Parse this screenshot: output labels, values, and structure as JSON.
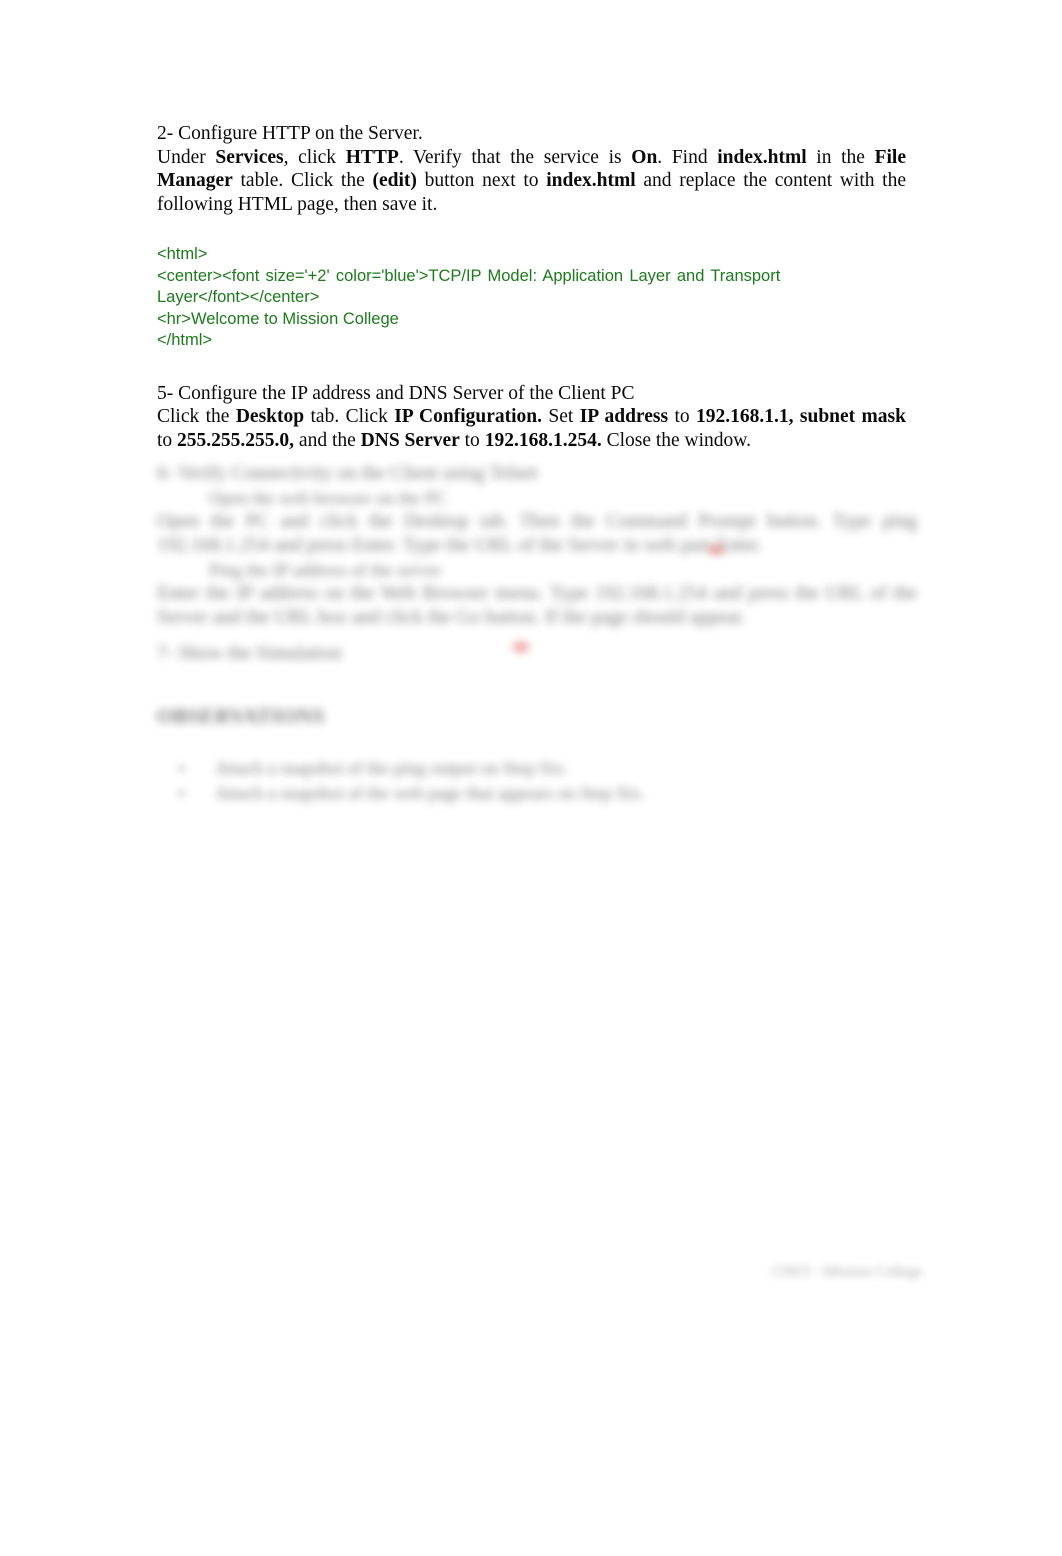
{
  "document": {
    "background_color": "#ffffff",
    "body_text_color": "#0a0a0a",
    "code_color": "#1d7a1d"
  },
  "section_http": {
    "heading": "2- Configure HTTP on the Server.",
    "body": {
      "p1": "Under ",
      "services": "Services",
      "p2": ", click ",
      "http": "HTTP",
      "p3": ". Verify that the service is ",
      "on": "On",
      "p4": ". Find ",
      "index_html_1": "index.html",
      "p5": " in the ",
      "file_manager": "File Manager",
      "p6": " table. Click the ",
      "edit": "(edit)",
      "p7": " button next to ",
      "index_html_2": "index.html",
      "p8": " and replace the content with the following HTML page, then save it."
    }
  },
  "code_block": {
    "line1": "<html>",
    "line2_a": "<center><font",
    "line2_b": "size='+2'",
    "line2_c": "color='blue'>TCP/IP",
    "line2_d": "Model:",
    "line2_e": "Application",
    "line2_f": "Layer",
    "line2_g": "and",
    "line2_h": "Transport",
    "line3": "Layer</font></center>",
    "line4": "<hr>Welcome to Mission College",
    "line5": "</html>"
  },
  "section_ip": {
    "heading": "5- Configure the IP address and DNS Server of the Client PC",
    "body": {
      "p1": "Click the ",
      "desktop": "Desktop",
      "p2": " tab. Click ",
      "ip_configuration": "IP Configuration.",
      "p3": " Set ",
      "ip_address": "IP address",
      "p4": " to ",
      "ip_value": "192.168.1.1, subnet mask",
      "p5": " to ",
      "mask_value": "255.255.255.0,",
      "p6": " and the ",
      "dns_server": "DNS Server",
      "p7": " to ",
      "dns_value": "192.168.1.254.",
      "p8": " Close the window."
    }
  },
  "redacted": {
    "note": "blurred-illegible",
    "line_a": "6- Verify Connectivity on the Client using Telnet",
    "line_b": "Open the web browser on the PC",
    "line_c": "Open the PC and click the Desktop tab. Then the Command Prompt button. Type ping 192.168.1.254 and press Enter. Type the URL of the Server in web part Enter.",
    "line_d": "Ping the IP address of the server",
    "line_e": "Enter the IP address on the Web Browser menu. Type 192.168.1.254 and press the URL of the Server and the URL box and click the Go button. If the page should appear.",
    "line_f": "7- Show the Simulation",
    "heading": "OBSERVATIONS",
    "bullet1": "Attach a snapshot of the ping output on Step Six.",
    "bullet2": "Attach a snapshot of the web page that appears on Step Six.",
    "footer": "CNET - Mission College"
  }
}
